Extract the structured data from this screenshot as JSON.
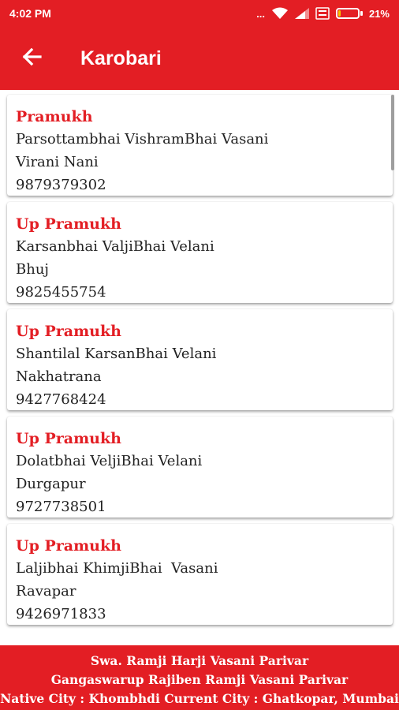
{
  "status": {
    "time": "4:02 PM",
    "dots": "...",
    "battery_percent": "21%",
    "battery_level": 0.21
  },
  "header": {
    "title": "Karobari"
  },
  "members": [
    {
      "role": "Pramukh",
      "name": "Parsottambhai VishramBhai Vasani",
      "place": "Virani Nani",
      "phone": "9879379302"
    },
    {
      "role": "Up Pramukh",
      "name": "Karsanbhai ValjiBhai Velani",
      "place": "Bhuj",
      "phone": "9825455754"
    },
    {
      "role": "Up Pramukh",
      "name": "Shantilal KarsanBhai Velani",
      "place": "Nakhatrana",
      "phone": "9427768424"
    },
    {
      "role": "Up Pramukh",
      "name": "Dolatbhai VeljiBhai Velani",
      "place": "Durgapur",
      "phone": "9727738501"
    },
    {
      "role": "Up Pramukh",
      "name": "Laljibhai KhimjiBhai  Vasani",
      "place": "Ravapar",
      "phone": "9426971833"
    }
  ],
  "footer": {
    "line1": "Swa. Ramji Harji Vasani Parivar",
    "line2": "Gangaswarup Rajiben Ramji Vasani Parivar",
    "line3": "Native City : Khombhdi Current City : Ghatkopar, Mumbai"
  },
  "colors": {
    "brand": "#e31e24",
    "role_text": "#e31e24",
    "battery_fill": "#f5c400"
  },
  "icons": {
    "back": "arrow-back-icon",
    "wifi": "wifi-icon",
    "signal": "signal-icon",
    "volte": "volte-icon",
    "battery": "battery-icon"
  }
}
